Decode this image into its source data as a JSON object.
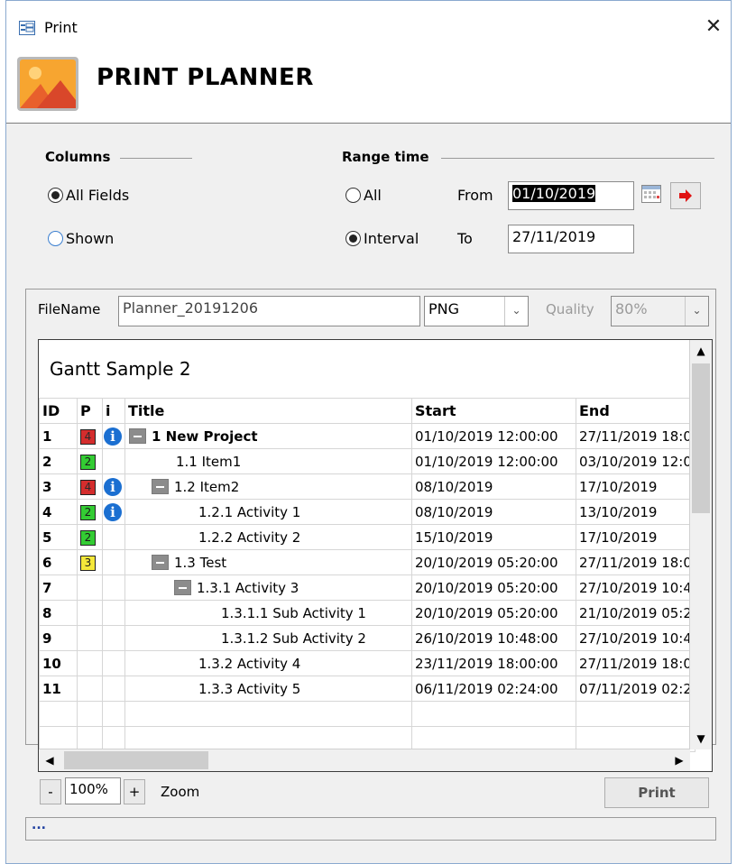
{
  "window": {
    "title": "Print",
    "close_glyph": "✕"
  },
  "header": {
    "title": "PRINT PLANNER",
    "image_icon": "landscape-image-icon"
  },
  "columns": {
    "label": "Columns",
    "options": [
      {
        "label": "All Fields",
        "checked": true
      },
      {
        "label": "Shown",
        "checked": false
      }
    ]
  },
  "range": {
    "label": "Range time",
    "options": [
      {
        "label": "All",
        "checked": false
      },
      {
        "label": "Interval",
        "checked": true
      }
    ],
    "from_label": "From",
    "from_value": "01/10/2019",
    "to_label": "To",
    "to_value": "27/11/2019",
    "calendar_icon": "calendar-icon",
    "go_icon": "red-arrow-right-icon"
  },
  "export": {
    "filename_label": "FileName",
    "filename_value": "Planner_20191206",
    "format_value": "PNG",
    "quality_label": "Quality",
    "quality_value": "80%"
  },
  "preview": {
    "title": "Gantt Sample 2",
    "columns": [
      "ID",
      "P",
      "i",
      "Title",
      "Start",
      "End"
    ],
    "rows": [
      {
        "id": "1",
        "p": "4",
        "pcolor": "red",
        "info": true,
        "level": 0,
        "collapse": true,
        "bold": true,
        "title": "1 New Project",
        "start": "01/10/2019 12:00:00",
        "end": "27/11/2019 18:0"
      },
      {
        "id": "2",
        "p": "2",
        "pcolor": "green",
        "info": false,
        "level": 1,
        "collapse": false,
        "bold": false,
        "title": "1.1 Item1",
        "start": "01/10/2019 12:00:00",
        "end": "03/10/2019 12:0"
      },
      {
        "id": "3",
        "p": "4",
        "pcolor": "red",
        "info": true,
        "level": 1,
        "collapse": true,
        "bold": false,
        "title": "1.2 Item2",
        "start": "08/10/2019",
        "end": "17/10/2019"
      },
      {
        "id": "4",
        "p": "2",
        "pcolor": "green",
        "info": true,
        "level": 2,
        "collapse": false,
        "bold": false,
        "title": "1.2.1 Activity 1",
        "start": "08/10/2019",
        "end": "13/10/2019"
      },
      {
        "id": "5",
        "p": "2",
        "pcolor": "green",
        "info": false,
        "level": 2,
        "collapse": false,
        "bold": false,
        "title": "1.2.2 Activity 2",
        "start": "15/10/2019",
        "end": "17/10/2019"
      },
      {
        "id": "6",
        "p": "3",
        "pcolor": "yellow",
        "info": false,
        "level": 1,
        "collapse": true,
        "bold": false,
        "title": "1.3 Test",
        "start": "20/10/2019 05:20:00",
        "end": "27/11/2019 18:0"
      },
      {
        "id": "7",
        "p": "",
        "pcolor": "",
        "info": false,
        "level": 2,
        "collapse": true,
        "bold": false,
        "title": "1.3.1 Activity 3",
        "start": "20/10/2019 05:20:00",
        "end": "27/10/2019 10:4"
      },
      {
        "id": "8",
        "p": "",
        "pcolor": "",
        "info": false,
        "level": 3,
        "collapse": false,
        "bold": false,
        "title": "1.3.1.1 Sub Activity 1",
        "start": "20/10/2019 05:20:00",
        "end": "21/10/2019 05:2"
      },
      {
        "id": "9",
        "p": "",
        "pcolor": "",
        "info": false,
        "level": 3,
        "collapse": false,
        "bold": false,
        "title": "1.3.1.2 Sub Activity 2",
        "start": "26/10/2019 10:48:00",
        "end": "27/10/2019 10:4"
      },
      {
        "id": "10",
        "p": "",
        "pcolor": "",
        "info": false,
        "level": 2,
        "collapse": false,
        "bold": false,
        "title": "1.3.2 Activity 4",
        "start": "23/11/2019 18:00:00",
        "end": "27/11/2019 18:0"
      },
      {
        "id": "11",
        "p": "",
        "pcolor": "",
        "info": false,
        "level": 2,
        "collapse": false,
        "bold": false,
        "title": "1.3.3 Activity 5",
        "start": "06/11/2019 02:24:00",
        "end": "07/11/2019 02:2"
      }
    ],
    "empty_rows": 2,
    "info_glyph": "i"
  },
  "zoom": {
    "minus": "-",
    "value": "100%",
    "plus": "+",
    "label": "Zoom"
  },
  "print_button": "Print",
  "status": "...",
  "colors": {
    "prio_red": "#d42d2d",
    "prio_green": "#33cc33",
    "prio_yellow": "#f5e83a",
    "info_blue": "#1b6fd1"
  }
}
